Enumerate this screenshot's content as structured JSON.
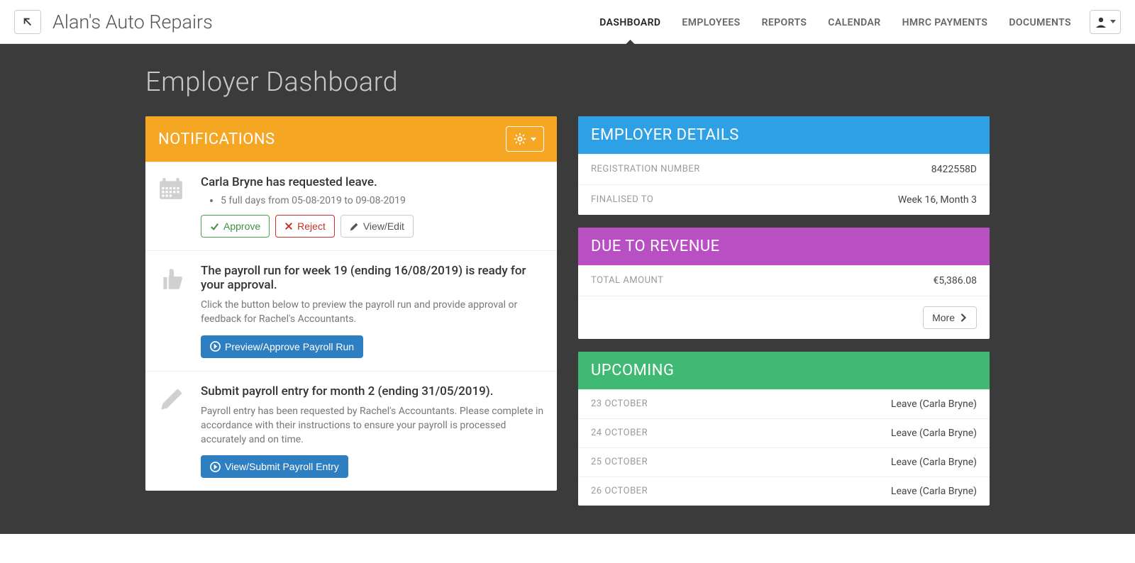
{
  "topbar": {
    "company": "Alan's Auto Repairs",
    "nav": [
      "DASHBOARD",
      "EMPLOYEES",
      "REPORTS",
      "CALENDAR",
      "HMRC PAYMENTS",
      "DOCUMENTS"
    ],
    "active_index": 0
  },
  "page_title": "Employer Dashboard",
  "notifications": {
    "title": "NOTIFICATIONS",
    "items": [
      {
        "icon": "calendar",
        "title": "Carla Bryne has requested leave.",
        "bullets": [
          "5 full days from 05-08-2019 to 09-08-2019"
        ],
        "actions": [
          {
            "style": "outline-green",
            "icon": "check",
            "label": "Approve"
          },
          {
            "style": "outline-red",
            "icon": "x",
            "label": "Reject"
          },
          {
            "style": "outline-grey",
            "icon": "pencil",
            "label": "View/Edit"
          }
        ]
      },
      {
        "icon": "thumbs-up",
        "title": "The payroll run for week 19 (ending 16/08/2019) is ready for your approval.",
        "desc": "Click the button below to preview the payroll run and provide approval or feedback for Rachel's Accountants.",
        "actions": [
          {
            "style": "blue",
            "icon": "arrow-circle",
            "label": "Preview/Approve Payroll Run"
          }
        ]
      },
      {
        "icon": "pencil-big",
        "title": "Submit payroll entry for month 2 (ending 31/05/2019).",
        "desc": "Payroll entry has been requested by Rachel's Accountants. Please complete in accordance with their instructions to ensure your payroll is processed accurately and on time.",
        "actions": [
          {
            "style": "blue",
            "icon": "arrow-circle",
            "label": "View/Submit Payroll Entry"
          }
        ]
      }
    ]
  },
  "employer_details": {
    "title": "EMPLOYER DETAILS",
    "rows": [
      {
        "label": "REGISTRATION NUMBER",
        "value": "8422558D"
      },
      {
        "label": "FINALISED TO",
        "value": "Week 16, Month 3"
      }
    ]
  },
  "due_to_revenue": {
    "title": "DUE TO REVENUE",
    "rows": [
      {
        "label": "TOTAL AMOUNT",
        "value": "€5,386.08"
      }
    ],
    "more_label": "More"
  },
  "upcoming": {
    "title": "UPCOMING",
    "rows": [
      {
        "date": "23 OCTOBER",
        "text": "Leave (Carla Bryne)"
      },
      {
        "date": "24 OCTOBER",
        "text": "Leave (Carla Bryne)"
      },
      {
        "date": "25 OCTOBER",
        "text": "Leave (Carla Bryne)"
      },
      {
        "date": "26 OCTOBER",
        "text": "Leave (Carla Bryne)"
      }
    ]
  }
}
